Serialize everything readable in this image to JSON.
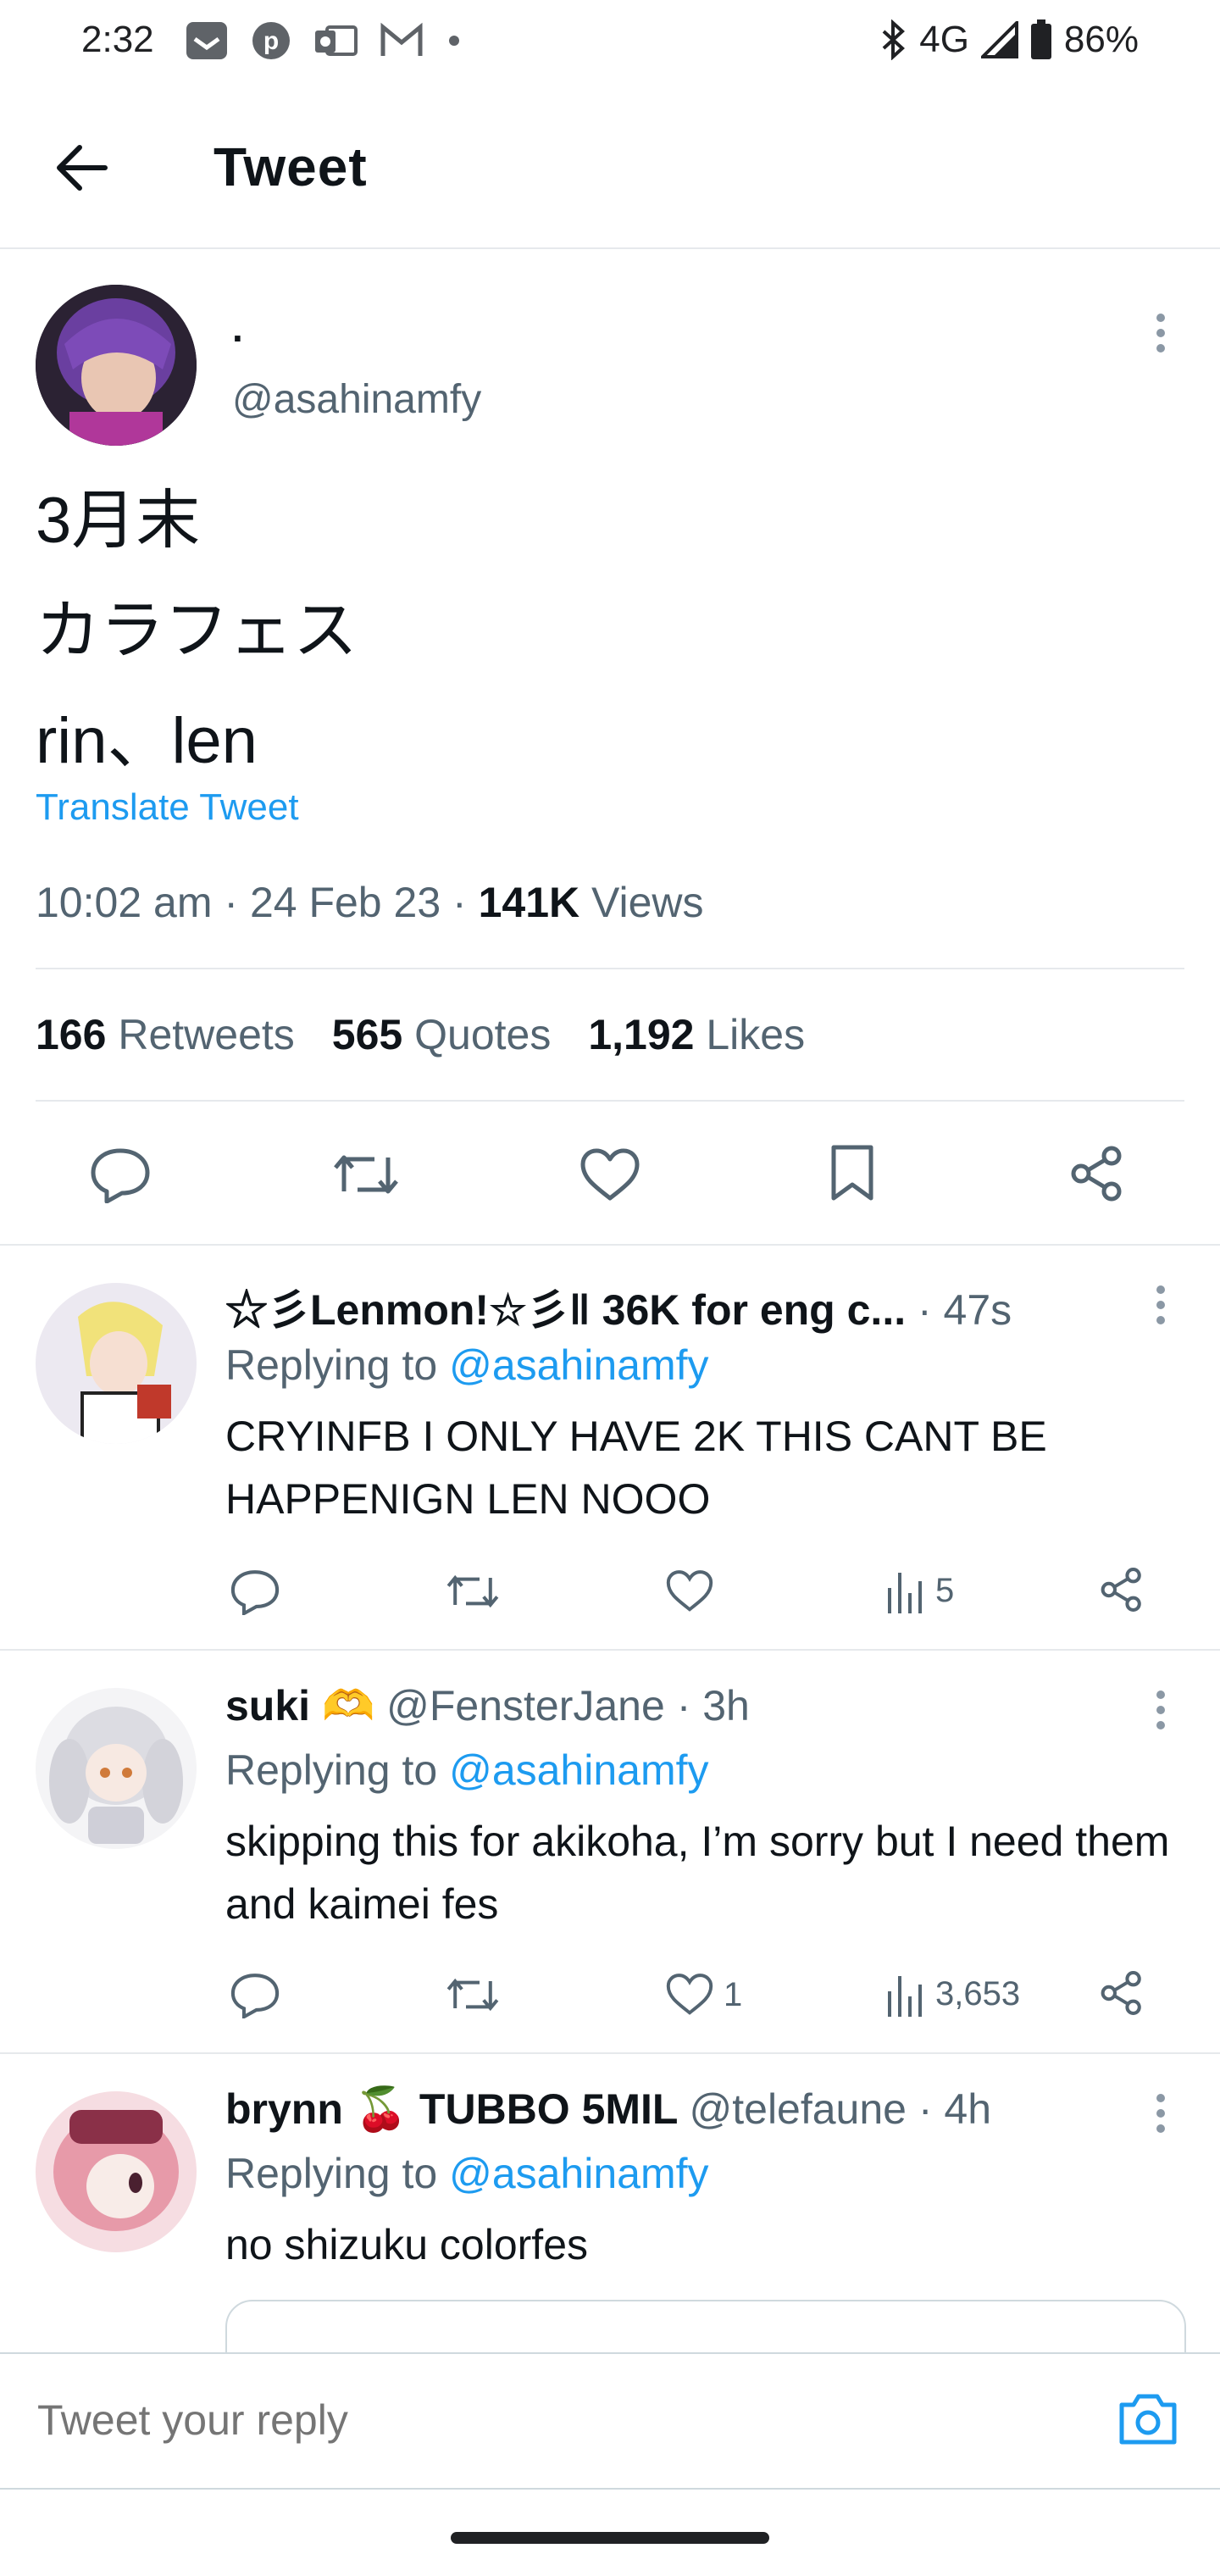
{
  "status_bar": {
    "time": "2:32",
    "network": "4G",
    "battery": "86%",
    "icons": [
      "inbox-icon",
      "pinterest-icon",
      "outlook-icon",
      "gmail-icon",
      "dot-icon",
      "bluetooth-icon",
      "signal-icon",
      "battery-icon"
    ]
  },
  "header": {
    "title": "Tweet"
  },
  "main_tweet": {
    "display_name": ".",
    "handle": "@asahinamfy",
    "text_lines": [
      "3月末",
      "カラフェス",
      "rin、len"
    ],
    "translate_label": "Translate Tweet",
    "time": "10:02 am",
    "date": "24 Feb 23",
    "views_count": "141K",
    "views_label": "Views",
    "retweets_count": "166",
    "retweets_label": "Retweets",
    "quotes_count": "565",
    "quotes_label": "Quotes",
    "likes_count": "1,192",
    "likes_label": "Likes",
    "sep": "·"
  },
  "replies": [
    {
      "name": "☆彡Lenmon!☆彡‖ 36K for eng c...",
      "handle": "",
      "time": "· 47s",
      "replying_label": "Replying to",
      "replying_to": "@asahinamfy",
      "body": "CRYINFB I ONLY HAVE 2K THIS CANT BE HAPPENIGN LEN NOOO",
      "likes": "",
      "views": "5",
      "avatar_color": "#e8e4ee"
    },
    {
      "name": "suki 🫶",
      "handle": "@FensterJane",
      "time": "· 3h",
      "replying_label": "Replying to",
      "replying_to": "@asahinamfy",
      "body": "skipping this for akikoha, I’m sorry but I need them and kaimei fes",
      "likes": "1",
      "views": "3,653",
      "avatar_color": "#e9e9ec"
    },
    {
      "name": "brynn 🍒 TUBBO 5MIL",
      "handle": "@telefaune",
      "time": "· 4h",
      "replying_label": "Replying to",
      "replying_to": "@asahinamfy",
      "body": "no shizuku colorfes",
      "likes": "",
      "views": "",
      "avatar_color": "#f2cfd6"
    }
  ],
  "reply_box": {
    "placeholder": "Tweet your reply"
  },
  "colors": {
    "accent": "#1d9bf0",
    "text": "#0f1419",
    "muted": "#536471",
    "divider": "#e6e9ec"
  }
}
